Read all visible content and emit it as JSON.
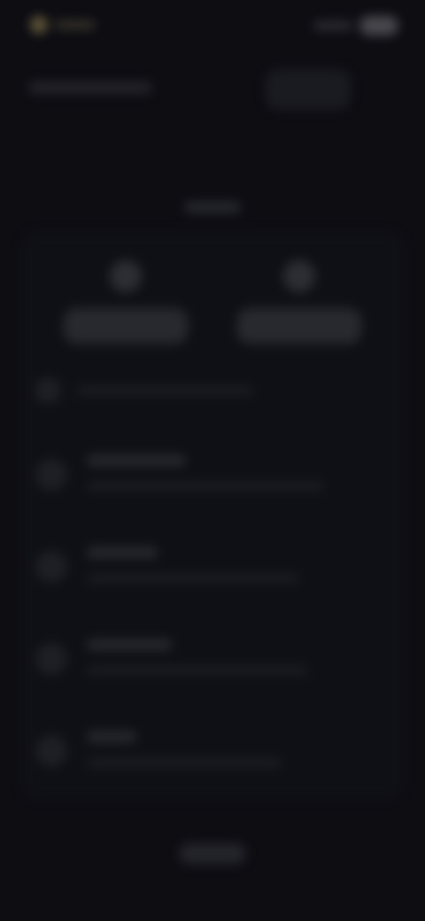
{
  "screen": {
    "note": ""
  },
  "status_bar": {
    "left_text": "",
    "right_text": ""
  },
  "header": {
    "left_text": "",
    "right_card_text": ""
  },
  "main": {
    "section_title": "",
    "actions": [
      {
        "label": ""
      },
      {
        "label": ""
      }
    ],
    "summary_row_text": "",
    "list": [
      {
        "title": "",
        "subtitle": ""
      },
      {
        "title": "",
        "subtitle": ""
      },
      {
        "title": "",
        "subtitle": ""
      },
      {
        "title": "",
        "subtitle": ""
      }
    ],
    "bottom_button_label": ""
  },
  "colors": {
    "background": "#0d0d12",
    "panel": "#101017",
    "accent_dim": "#8a7a4e"
  },
  "icons": {
    "status_left": "app-icon",
    "action_left": "avatar-icon",
    "action_right": "avatar-icon",
    "summary": "info-icon",
    "list_item": "circle-icon"
  }
}
